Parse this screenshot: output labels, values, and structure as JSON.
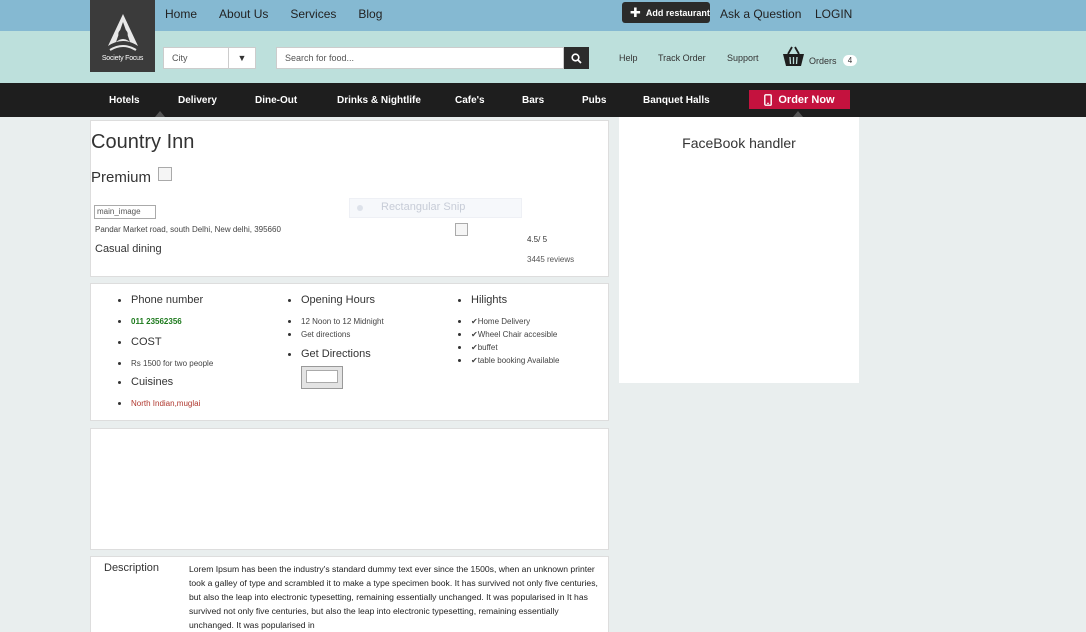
{
  "topnav": {
    "home": "Home",
    "about": "About Us",
    "services": "Services",
    "blog": "Blog"
  },
  "header": {
    "add_restaurant": "Add restaurant",
    "ask": "Ask a Question",
    "login": "LOGIN"
  },
  "logo": {
    "text": "Society Focus"
  },
  "search": {
    "city_placeholder": "City",
    "food_placeholder": "Search for food..."
  },
  "util": {
    "help": "Help",
    "track": "Track Order",
    "support": "Support",
    "orders": "Orders",
    "orders_count": "4"
  },
  "categories": [
    "Hotels",
    "Delivery",
    "Dine-Out",
    "Drinks & Nightlife",
    "Cafe's",
    "Bars",
    "Pubs",
    "Banquet Halls"
  ],
  "order_now": "Order Now",
  "restaurant": {
    "name": "Country Inn",
    "tier": "Premium",
    "main_image_alt": "main_image",
    "address": "Pandar Market road, south Delhi, New delhi, 395660",
    "type": "Casual dining",
    "snip_text": "Rectangular Snip",
    "rating": "4.5/ 5",
    "reviews": "3445 reviews"
  },
  "details": {
    "phone_label": "Phone number",
    "phone": "011 23562356",
    "cost_label": "COST",
    "cost": "Rs 1500 for two people",
    "cuisines_label": "Cuisines",
    "cuisines": "North Indian,muglai",
    "hours_label": "Opening Hours",
    "hours": "12 Noon to 12 Midnight",
    "get_directions_link": "Get directions",
    "directions_label": "Get Directions",
    "highlights_label": "Hilights",
    "highlights": [
      "Home Delivery",
      "Wheel Chair accesible",
      "buffet",
      "table booking Available"
    ]
  },
  "description": {
    "label": "Description",
    "text": "Lorem Ipsum has been the industry's standard dummy text ever since the 1500s, when an unknown printer took a galley of type and scrambled it to make a type specimen book. It has survived not only five centuries, but also the leap into electronic typesetting, remaining essentially unchanged. It was popularised in It has survived not only five centuries, but also the leap into electronic typesetting, remaining essentially unchanged. It was popularised in"
  },
  "facebook": {
    "title": "FaceBook handler"
  },
  "colors": {
    "topbar": "#85b9d2",
    "secbar": "#bde0dc",
    "catnav": "#1e1e1e",
    "order_now": "#c4123e"
  }
}
